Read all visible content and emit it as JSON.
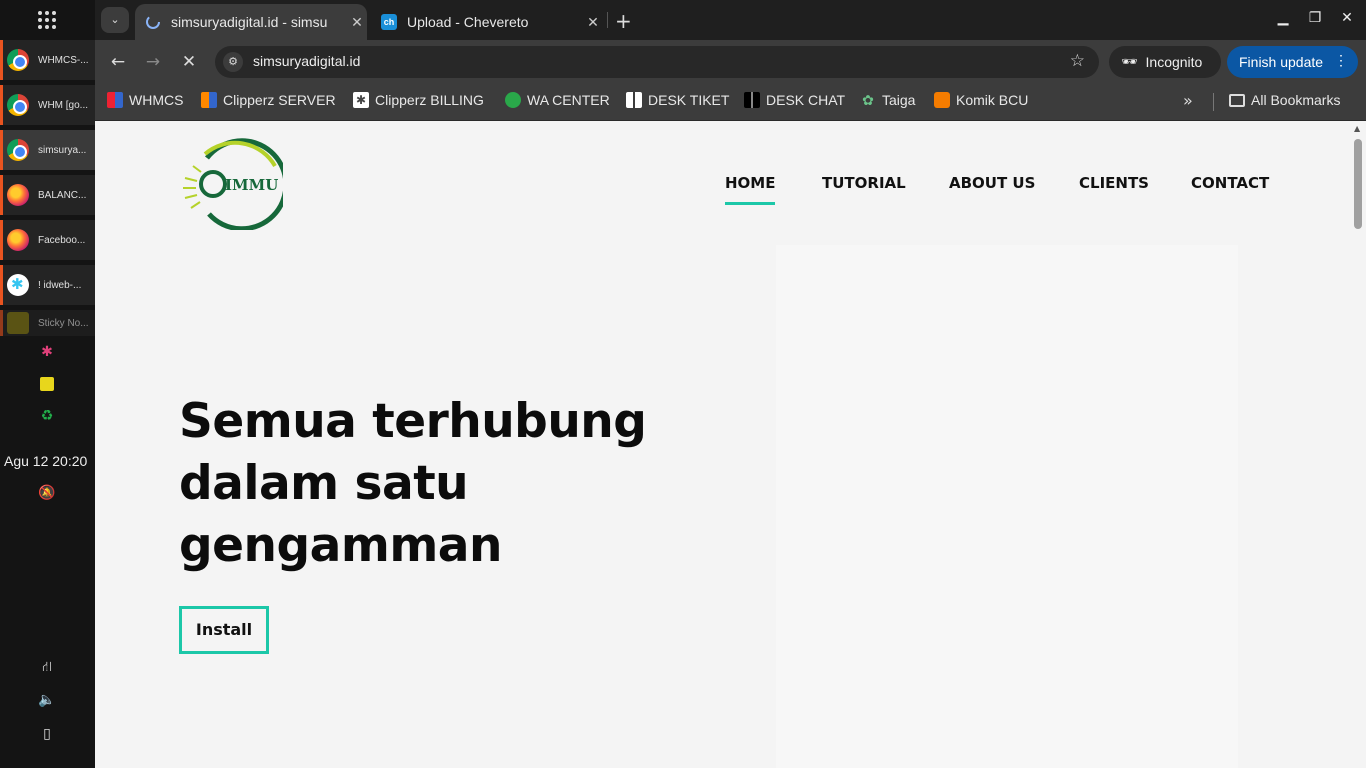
{
  "taskbar": {
    "items": [
      {
        "label": "WHMCS-...",
        "icon": "chrome-icon"
      },
      {
        "label": "WHM [go...",
        "icon": "chrome-icon"
      },
      {
        "label": "simsurya...",
        "icon": "chrome-icon"
      },
      {
        "label": "BALANC...",
        "icon": "firefox-icon"
      },
      {
        "label": "Faceboo...",
        "icon": "firefox-icon"
      },
      {
        "label": "! idweb-...",
        "icon": "slack-icon"
      },
      {
        "label": "Sticky No...",
        "icon": "sticky-notes-icon"
      }
    ],
    "clock": "Agu 12  20:20"
  },
  "browser": {
    "tabs": [
      {
        "title": "simsuryadigital.id - simsu",
        "active": true
      },
      {
        "title": "Upload - Chevereto",
        "active": false
      }
    ],
    "url": "simsuryadigital.id",
    "incognito_label": "Incognito",
    "finish_update_label": "Finish update",
    "bookmarks": [
      {
        "label": "WHMCS"
      },
      {
        "label": "Clipperz SERVER"
      },
      {
        "label": "Clipperz BILLING"
      },
      {
        "label": "WA CENTER"
      },
      {
        "label": "DESK TIKET"
      },
      {
        "label": "DESK CHAT"
      },
      {
        "label": "Taiga"
      },
      {
        "label": "Komik BCU"
      }
    ],
    "all_bookmarks_label": "All Bookmarks"
  },
  "page": {
    "logo_text": "IMMU",
    "nav": [
      {
        "label": "HOME",
        "active": true
      },
      {
        "label": "TUTORIAL"
      },
      {
        "label": "ABOUT US"
      },
      {
        "label": "CLIENTS"
      },
      {
        "label": "CONTACT"
      }
    ],
    "hero": {
      "title_line1": "Semua terhubung",
      "title_line2": "dalam satu",
      "title_line3": "gengamman",
      "button_label": "Install"
    },
    "accent_color": "#1cc7a8"
  }
}
